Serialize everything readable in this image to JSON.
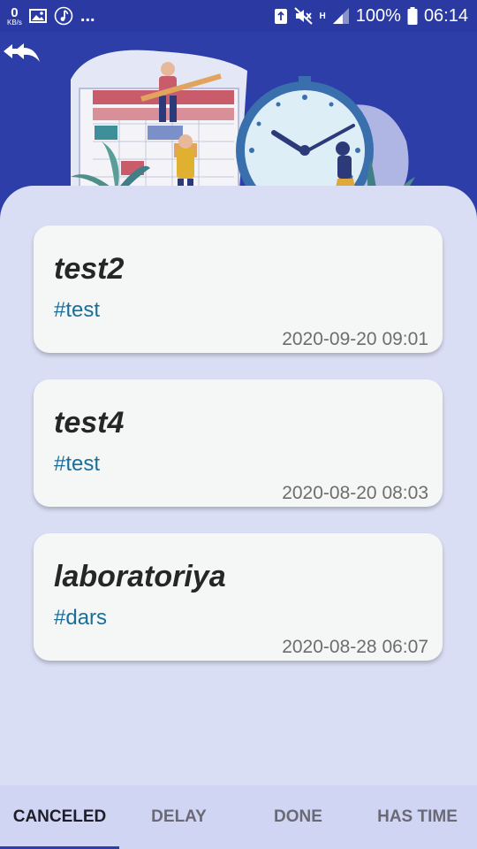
{
  "status_bar": {
    "speed_value": "0",
    "speed_unit": "KB/s",
    "overflow": "...",
    "network_label": "H",
    "battery": "100%",
    "time": "06:14"
  },
  "tasks": [
    {
      "title": "test2",
      "tag": "#test",
      "date": "2020-09-20 09:01"
    },
    {
      "title": "test4",
      "tag": "#test",
      "date": "2020-08-20 08:03"
    },
    {
      "title": "laboratoriya",
      "tag": "#dars",
      "date": "2020-08-28 06:07"
    }
  ],
  "tabs": [
    {
      "label": "CANCELED",
      "active": true
    },
    {
      "label": "DELAY",
      "active": false
    },
    {
      "label": "DONE",
      "active": false
    },
    {
      "label": "HAS TIME",
      "active": false
    }
  ],
  "colors": {
    "header": "#2e3ea8",
    "status_bar": "#2a3aa2",
    "panel": "#dadef5",
    "card": "#f5f7f7",
    "tag": "#1a6f9a",
    "tabbar": "#d0d5f3"
  },
  "icons": [
    "image-icon",
    "music-icon",
    "recycle-icon",
    "mute-icon",
    "signal-icon",
    "battery-icon",
    "double-back-arrow-icon"
  ]
}
